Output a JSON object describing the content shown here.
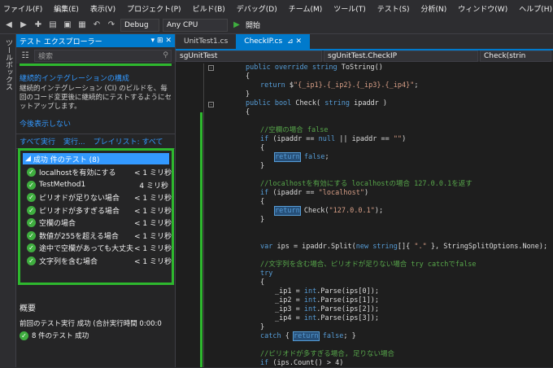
{
  "menu": [
    "ファイル(F)",
    "編集(E)",
    "表示(V)",
    "プロジェクト(P)",
    "ビルド(B)",
    "デバッグ(D)",
    "チーム(M)",
    "ツール(T)",
    "テスト(S)",
    "分析(N)",
    "ウィンドウ(W)",
    "ヘルプ(H)"
  ],
  "toolbar": {
    "config": "Debug",
    "platform": "Any CPU",
    "start": "開始"
  },
  "side_strip": "ツールボックス",
  "explorer": {
    "title": "テスト エクスプローラー",
    "search_placeholder": "検索",
    "ci_title": "継続的インテグレーションの構成",
    "ci_desc": "継続的インテグレーション (CI) のビルドを、毎回のコード変更後に継続的にテストするようにセットアップします。",
    "ci_dismiss": "今後表示しない",
    "run_all": "すべて実行",
    "run": "実行...",
    "playlist": "プレイリスト: すべて",
    "group": "成功 件のテスト (8)",
    "tests": [
      {
        "name": "localhostを有効にする",
        "time": "< 1 ミリ秒"
      },
      {
        "name": "TestMethod1",
        "time": "4 ミリ秒"
      },
      {
        "name": "ピリオドが足りない場合",
        "time": "< 1 ミリ秒"
      },
      {
        "name": "ピリオドが多すぎる場合",
        "time": "< 1 ミリ秒"
      },
      {
        "name": "空欄の場合",
        "time": "< 1 ミリ秒"
      },
      {
        "name": "数値が255を超える場合",
        "time": "< 1 ミリ秒"
      },
      {
        "name": "途中で空欄があっても大丈夫",
        "time": "< 1 ミリ秒"
      },
      {
        "name": "文字列を含む場合",
        "time": "< 1 ミリ秒"
      }
    ],
    "summary_title": "概要",
    "summary_last": "前回のテスト実行 成功 (合計実行時間 0:00:0",
    "summary_count": "8 件のテスト 成功"
  },
  "editor": {
    "tabs": [
      "UnitTest1.cs",
      "CheckIP.cs"
    ],
    "nav_left": "sgUnitTest",
    "nav_mid": "sgUnitTest.CheckIP",
    "nav_right": "Check(strin"
  }
}
